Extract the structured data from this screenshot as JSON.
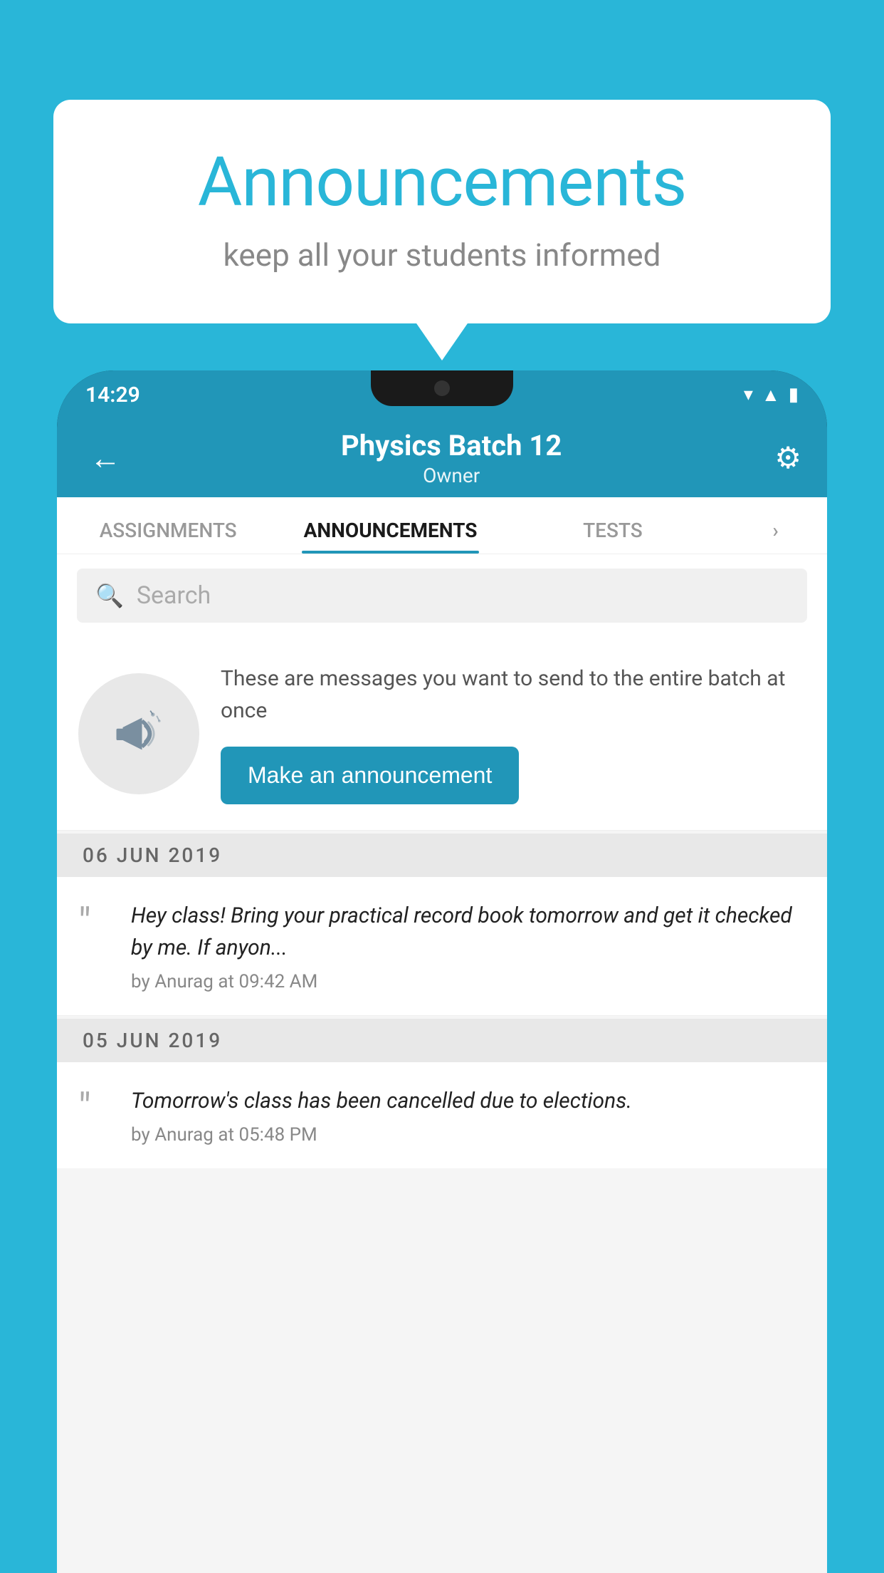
{
  "background_color": "#29b6d8",
  "speech_bubble": {
    "title": "Announcements",
    "subtitle": "keep all your students informed"
  },
  "status_bar": {
    "time": "14:29",
    "icons": [
      "wifi",
      "signal",
      "battery"
    ]
  },
  "app_bar": {
    "back_icon": "←",
    "batch_name": "Physics Batch 12",
    "batch_role": "Owner",
    "settings_icon": "⚙"
  },
  "tabs": [
    {
      "label": "ASSIGNMENTS",
      "active": false
    },
    {
      "label": "ANNOUNCEMENTS",
      "active": true
    },
    {
      "label": "TESTS",
      "active": false
    },
    {
      "label": "...",
      "active": false
    }
  ],
  "search": {
    "placeholder": "Search"
  },
  "announcement_prompt": {
    "description": "These are messages you want to send to the entire batch at once",
    "cta_label": "Make an announcement"
  },
  "announcements": [
    {
      "date": "06  JUN  2019",
      "text": "Hey class! Bring your practical record book tomorrow and get it checked by me. If anyon...",
      "meta": "by Anurag at 09:42 AM"
    },
    {
      "date": "05  JUN  2019",
      "text": "Tomorrow's class has been cancelled due to elections.",
      "meta": "by Anurag at 05:48 PM"
    }
  ]
}
